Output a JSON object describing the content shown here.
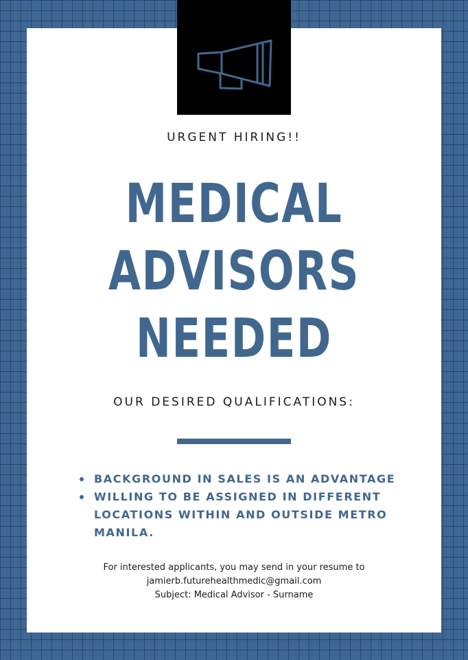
{
  "icon": "megaphone-icon",
  "colors": {
    "frame": "#3e6793",
    "accent": "#41678f",
    "card": "#ffffff",
    "icon_box": "#000000"
  },
  "eyebrow": "URGENT HIRING!!",
  "headline": {
    "lines": [
      "MEDICAL",
      "ADVISORS",
      "NEEDED"
    ]
  },
  "subhead": "OUR DESIRED QUALIFICATIONS:",
  "qualifications": [
    "BACKGROUND IN SALES IS AN ADVANTAGE",
    "WILLING TO BE ASSIGNED IN DIFFERENT LOCATIONS WITHIN AND OUTSIDE METRO MANILA."
  ],
  "contact": {
    "line1": "For interested applicants, you may send in your resume to",
    "email": "jamierb.futurehealthmedic@gmail.com",
    "subject": "Subject: Medical Advisor - Surname"
  }
}
